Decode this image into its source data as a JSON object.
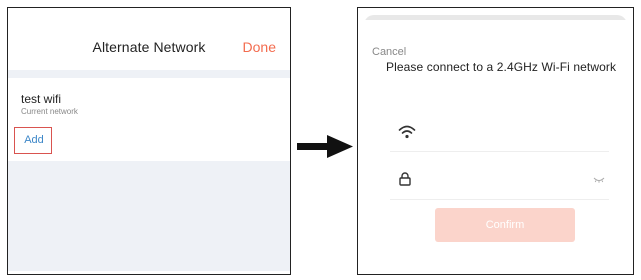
{
  "left_screen": {
    "title": "Alternate Network",
    "done_label": "Done",
    "network": {
      "name": "test wifi",
      "status": "Current network"
    },
    "add_label": "Add",
    "colors": {
      "done": "#f36c4f",
      "add_text": "#3d87c8",
      "add_highlight_border": "#d9534f",
      "gray_area": "#eef1f6"
    }
  },
  "right_screen": {
    "cancel_label": "Cancel",
    "title": "Please connect to a 2.4GHz Wi-Fi network",
    "wifi_icon": "wifi-icon",
    "lock_icon": "lock-icon",
    "eye_icon": "eye-closed-icon",
    "confirm_label": "Confirm",
    "colors": {
      "confirm_bg": "#fbd4cb",
      "cancel_text": "#888888"
    }
  },
  "arrow_icon": "right-arrow-icon"
}
